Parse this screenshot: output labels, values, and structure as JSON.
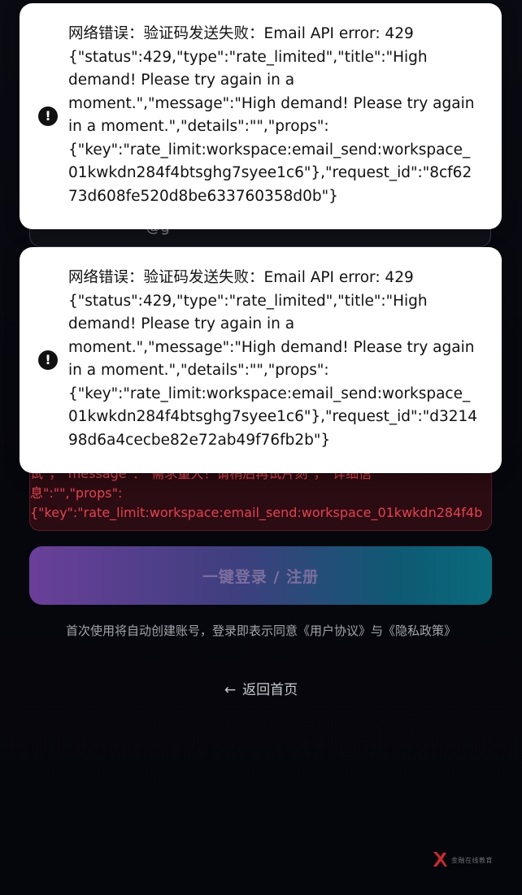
{
  "form": {
    "email_value": "· · · · · · · · · · @g· · · · ·",
    "error_text": "试\"，\"message\"：\"需求量大！请稍后再试片刻\"，\"详细信\n息\":\"\",\"props\":\n{\"key\":\"rate_limit:workspace:email_send:workspace_01kwkdn284f4b",
    "login_button_label": "一键登录 / 注册",
    "agreement_text": "首次使用将自动创建账号，登录即表示同意《用户协议》与《隐私政策》",
    "back_link_label": "返回首页",
    "back_link_icon": "arrow-left-icon"
  },
  "toasts": [
    {
      "icon": "exclamation-circle-icon",
      "message": "网络错误：验证码发送失败：Email API error: 429\n{\"status\":429,\"type\":\"rate_limited\",\"title\":\"High\ndemand! Please try again in a\nmoment.\",\"message\":\"High demand! Please try again\nin a moment.\",\"details\":\"\",\"props\":\n{\"key\":\"rate_limit:workspace:email_send:workspace_\n01kwkdn284f4btsghg7syee1c6\"},\"request_id\":\"8cf62\n73d608fe520d8be633760358d0b\"}"
    },
    {
      "icon": "exclamation-circle-icon",
      "message": "网络错误：验证码发送失败：Email API error: 429\n{\"status\":429,\"type\":\"rate_limited\",\"title\":\"High\ndemand! Please try again in a\nmoment.\",\"message\":\"High demand! Please try again\nin a moment.\",\"details\":\"\",\"props\":\n{\"key\":\"rate_limit:workspace:email_send:workspace_\n01kwkdn284f4btsghg7syee1c6\"},\"request_id\":\"d3214\n98d6a4cecbe82e72ab49f76fb2b\"}"
    }
  ],
  "watermark": {
    "text": "金融在线教育",
    "icon": "brand-logo-icon"
  },
  "colors": {
    "background": "#05060b",
    "error_red": "#e8404f",
    "toast_bg": "#ffffff",
    "button_gradient_start": "#6a3f9a",
    "button_gradient_end": "#0a6b7c"
  }
}
